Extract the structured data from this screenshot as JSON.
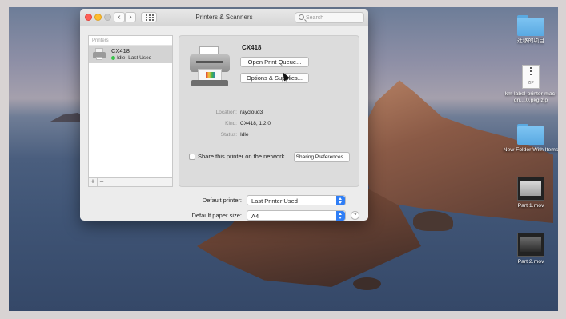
{
  "window": {
    "title": "Printers & Scanners",
    "search_placeholder": "Search"
  },
  "printer_list": {
    "header": "Printers",
    "items": [
      {
        "name": "CX418",
        "status": "Idle, Last Used",
        "status_color": "#39c34b"
      }
    ],
    "add_label": "+",
    "remove_label": "−"
  },
  "detail": {
    "printer_name": "CX418",
    "open_queue_label": "Open Print Queue...",
    "options_label": "Options & Supplies...",
    "location_label": "Location:",
    "location_value": "raycloud3",
    "kind_label": "Kind:",
    "kind_value": "CX418, 1.2.0",
    "status_label": "Status:",
    "status_value": "Idle",
    "share_label": "Share this printer on the network",
    "share_prefs_label": "Sharing Preferences...",
    "share_checked": false
  },
  "defaults": {
    "default_printer_label": "Default printer:",
    "default_printer_value": "Last Printer Used",
    "paper_size_label": "Default paper size:",
    "paper_size_value": "A4",
    "help_label": "?"
  },
  "desktop_icons": [
    {
      "label": "迁移的项目",
      "icon": "folder-icon"
    },
    {
      "label": "km-label-printer-mac-dri....0.pkg.zip",
      "icon": "zip-file-icon"
    },
    {
      "label": "New Folder With Items",
      "icon": "folder-icon"
    },
    {
      "label": "Part 1.mov",
      "icon": "video-file-icon"
    },
    {
      "label": "Part 2.mov",
      "icon": "video-file-icon"
    }
  ],
  "colors": {
    "accent": "#2f7ef6",
    "close": "#fd5f57",
    "minimize": "#febc2e"
  }
}
